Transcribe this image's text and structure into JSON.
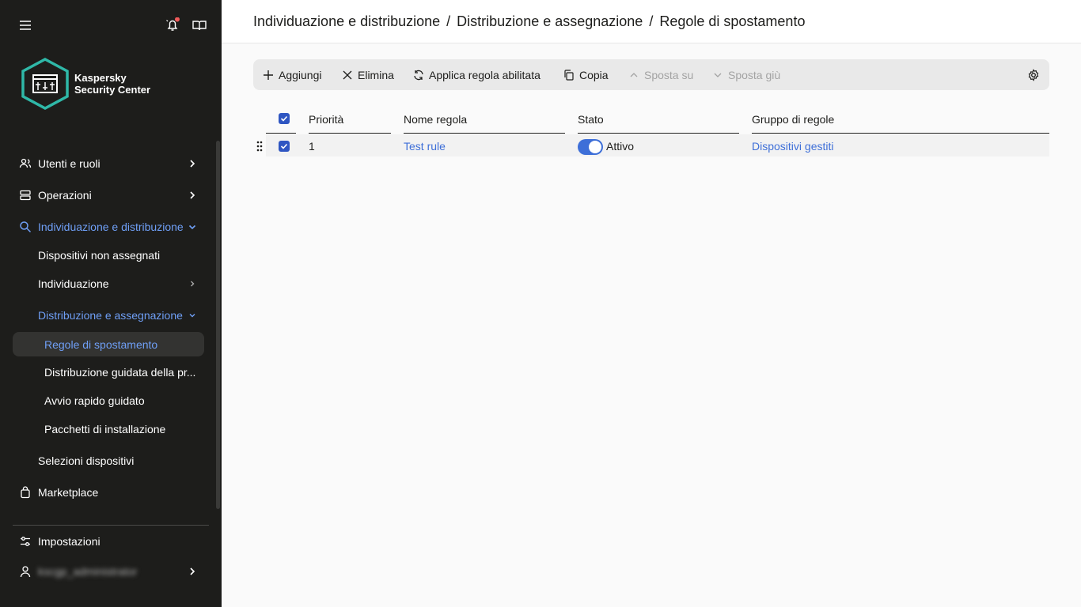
{
  "sidebar": {
    "logo_line1": "Kaspersky",
    "logo_line2": "Security Center",
    "items": [
      {
        "label": "Utenti e ruoli",
        "icon": "users-icon"
      },
      {
        "label": "Operazioni",
        "icon": "operations-icon"
      },
      {
        "label": "Individuazione e distribuzione",
        "icon": "search-icon"
      },
      {
        "label": "Dispositivi non assegnati"
      },
      {
        "label": "Individuazione"
      },
      {
        "label": "Distribuzione e assegnazione"
      },
      {
        "label": "Regole di spostamento"
      },
      {
        "label": "Distribuzione guidata della pr..."
      },
      {
        "label": "Avvio rapido guidato"
      },
      {
        "label": "Pacchetti di installazione"
      },
      {
        "label": "Selezioni dispositivi"
      },
      {
        "label": "Marketplace",
        "icon": "bag-icon"
      },
      {
        "label": "Impostazioni",
        "icon": "settings-sliders-icon"
      },
      {
        "label": "kscgp_administrator",
        "icon": "user-icon"
      }
    ]
  },
  "header": {
    "crumb1": "Individuazione e distribuzione",
    "crumb2": "Distribuzione e assegnazione",
    "crumb3": "Regole di spostamento",
    "sep": "/"
  },
  "toolbar": {
    "add": "Aggiungi",
    "delete": "Elimina",
    "apply": "Applica regola abilitata",
    "copy": "Copia",
    "move_up": "Sposta su",
    "move_down": "Sposta giù"
  },
  "table": {
    "headers": [
      "Priorità",
      "Nome regola",
      "Stato",
      "Gruppo di regole"
    ],
    "rows": [
      {
        "priority": "1",
        "name": "Test rule",
        "state": "Attivo",
        "group": "Dispositivi gestiti",
        "enabled": true,
        "checked": true
      }
    ]
  },
  "colors": {
    "accent": "#3e6fd8",
    "sidebar_bg": "#1d1d1b",
    "logo_teal": "#2fb8a8",
    "notification": "#f05a5a"
  }
}
